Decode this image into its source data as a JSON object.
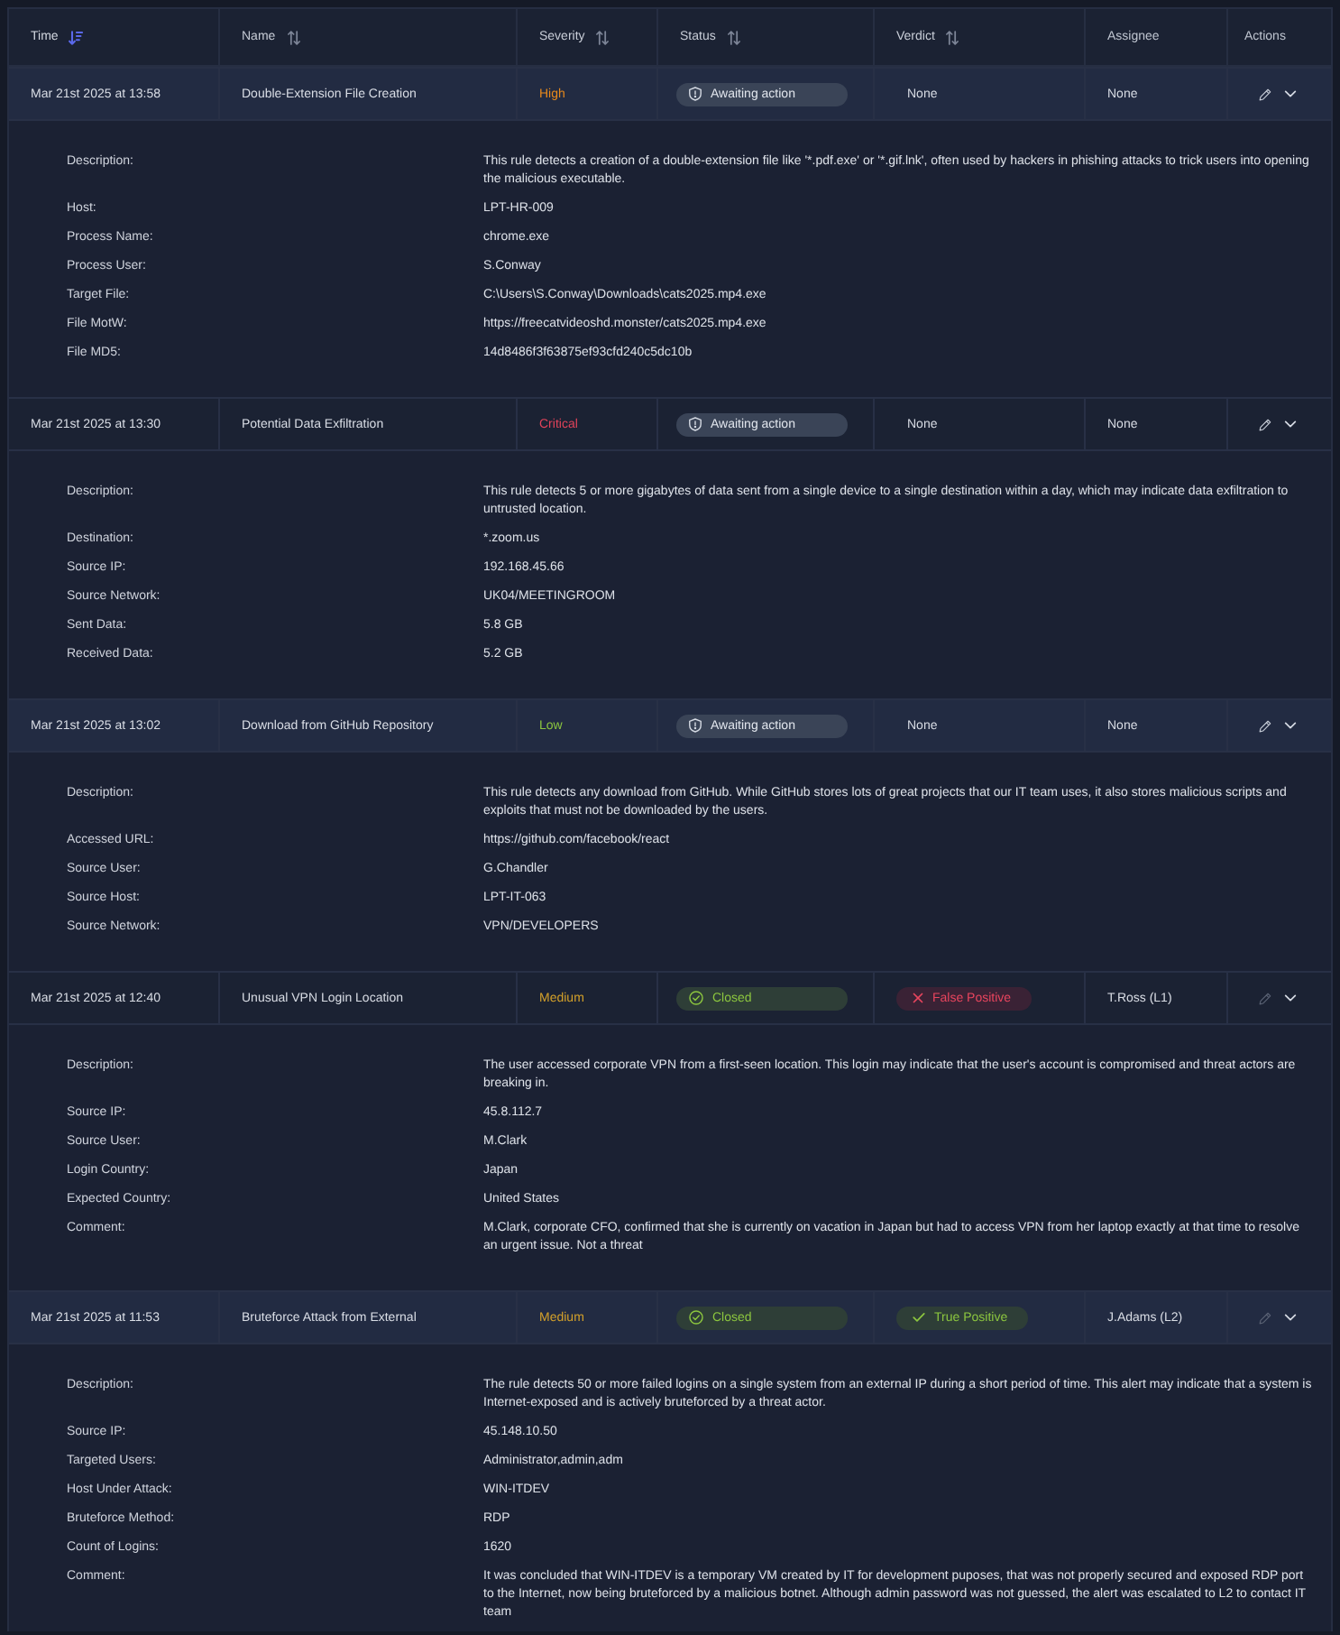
{
  "table": {
    "columns": [
      {
        "label": "Time",
        "kind": "sorted"
      },
      {
        "label": "Name",
        "kind": "sortable"
      },
      {
        "label": "Severity",
        "kind": "sortable"
      },
      {
        "label": "Status",
        "kind": "sortable"
      },
      {
        "label": "Verdict",
        "kind": "sortable"
      },
      {
        "label": "Assignee",
        "kind": "plain"
      },
      {
        "label": "Actions",
        "kind": "plain"
      }
    ],
    "alerts": [
      {
        "time": "Mar 21st 2025 at 13:58",
        "name": "Double-Extension File Creation",
        "severity": {
          "text": "High",
          "color": "#e8891c"
        },
        "status": {
          "text": "Awaiting action",
          "kind": "awaiting"
        },
        "verdict": {
          "text": "None",
          "kind": "none"
        },
        "assignee": "None",
        "editable": true,
        "expanded": true,
        "details": [
          {
            "label": "Description:",
            "value": "This rule detects a creation of a double-extension file like '*.pdf.exe' or '*.gif.lnk', often used by hackers in phishing attacks to trick users into opening the malicious executable."
          },
          {
            "label": "Host:",
            "value": "LPT-HR-009"
          },
          {
            "label": "Process Name:",
            "value": "chrome.exe"
          },
          {
            "label": "Process User:",
            "value": "S.Conway"
          },
          {
            "label": "Target File:",
            "value": "C:\\Users\\S.Conway\\Downloads\\cats2025.mp4.exe"
          },
          {
            "label": "File MotW:",
            "value": "https://freecatvideoshd.monster/cats2025.mp4.exe"
          },
          {
            "label": "File MD5:",
            "value": "14d8486f3f63875ef93cfd240c5dc10b"
          }
        ]
      },
      {
        "time": "Mar 21st 2025 at 13:30",
        "name": "Potential Data Exfiltration",
        "severity": {
          "text": "Critical",
          "color": "#e0435a"
        },
        "status": {
          "text": "Awaiting action",
          "kind": "awaiting"
        },
        "verdict": {
          "text": "None",
          "kind": "none"
        },
        "assignee": "None",
        "editable": true,
        "expanded": true,
        "details": [
          {
            "label": "Description:",
            "value": "This rule detects 5 or more gigabytes of data sent from a single device to a single destination within a day, which may indicate data exfiltration to untrusted location."
          },
          {
            "label": "Destination:",
            "value": "*.zoom.us"
          },
          {
            "label": "Source IP:",
            "value": "192.168.45.66"
          },
          {
            "label": "Source Network:",
            "value": "UK04/MEETINGROOM"
          },
          {
            "label": "Sent Data:",
            "value": "5.8 GB"
          },
          {
            "label": "Received Data:",
            "value": "5.2 GB"
          }
        ]
      },
      {
        "time": "Mar 21st 2025 at 13:02",
        "name": "Download from GitHub Repository",
        "severity": {
          "text": "Low",
          "color": "#8cc63f"
        },
        "status": {
          "text": "Awaiting action",
          "kind": "awaiting"
        },
        "verdict": {
          "text": "None",
          "kind": "none"
        },
        "assignee": "None",
        "editable": true,
        "expanded": true,
        "details": [
          {
            "label": "Description:",
            "value": "This rule detects any download from GitHub. While GitHub stores lots of great projects that our IT team uses, it also stores malicious scripts and exploits that must not be downloaded by the users."
          },
          {
            "label": "Accessed URL:",
            "value": "https://github.com/facebook/react"
          },
          {
            "label": "Source User:",
            "value": "G.Chandler"
          },
          {
            "label": "Source Host:",
            "value": "LPT-IT-063"
          },
          {
            "label": "Source Network:",
            "value": "VPN/DEVELOPERS"
          }
        ]
      },
      {
        "time": "Mar 21st 2025 at 12:40",
        "name": "Unusual VPN Login Location",
        "severity": {
          "text": "Medium",
          "color": "#d4a12a"
        },
        "status": {
          "text": "Closed",
          "kind": "closed"
        },
        "verdict": {
          "text": "False Positive",
          "kind": "false_positive"
        },
        "assignee": "T.Ross (L1)",
        "editable": false,
        "expanded": true,
        "details": [
          {
            "label": "Description:",
            "value": "The user accessed corporate VPN from a first-seen location. This login may indicate that the user's account is compromised and threat actors are breaking in."
          },
          {
            "label": "Source IP:",
            "value": "45.8.112.7"
          },
          {
            "label": "Source User:",
            "value": "M.Clark"
          },
          {
            "label": "Login Country:",
            "value": "Japan"
          },
          {
            "label": "Expected Country:",
            "value": "United States"
          },
          {
            "label": "Comment:",
            "value": "M.Clark, corporate CFO, confirmed that she is currently on vacation in Japan but had to access VPN from her laptop exactly at that time to resolve an urgent issue. Not a threat"
          }
        ]
      },
      {
        "time": "Mar 21st 2025 at 11:53",
        "name": "Bruteforce Attack from External",
        "severity": {
          "text": "Medium",
          "color": "#d4a12a"
        },
        "status": {
          "text": "Closed",
          "kind": "closed"
        },
        "verdict": {
          "text": "True Positive",
          "kind": "true_positive"
        },
        "assignee": "J.Adams (L2)",
        "editable": false,
        "expanded": true,
        "details": [
          {
            "label": "Description:",
            "value": "The rule detects 50 or more failed logins on a single system from an external IP during a short period of time. This alert may indicate that a system is Internet-exposed and is actively bruteforced by a threat actor."
          },
          {
            "label": "Source IP:",
            "value": "45.148.10.50"
          },
          {
            "label": "Targeted Users:",
            "value": "Administrator,admin,adm"
          },
          {
            "label": "Host Under Attack:",
            "value": "WIN-ITDEV"
          },
          {
            "label": "Bruteforce Method:",
            "value": "RDP"
          },
          {
            "label": "Count of Logins:",
            "value": "1620"
          },
          {
            "label": "Comment:",
            "value": "It was concluded that WIN-ITDEV is a temporary VM created by IT for development puposes, that was not properly secured and exposed RDP port to the Internet, now being bruteforced by a malicious botnet. Although admin password was not guessed, the alert was escalated to L2 to contact IT team"
          }
        ]
      }
    ]
  }
}
